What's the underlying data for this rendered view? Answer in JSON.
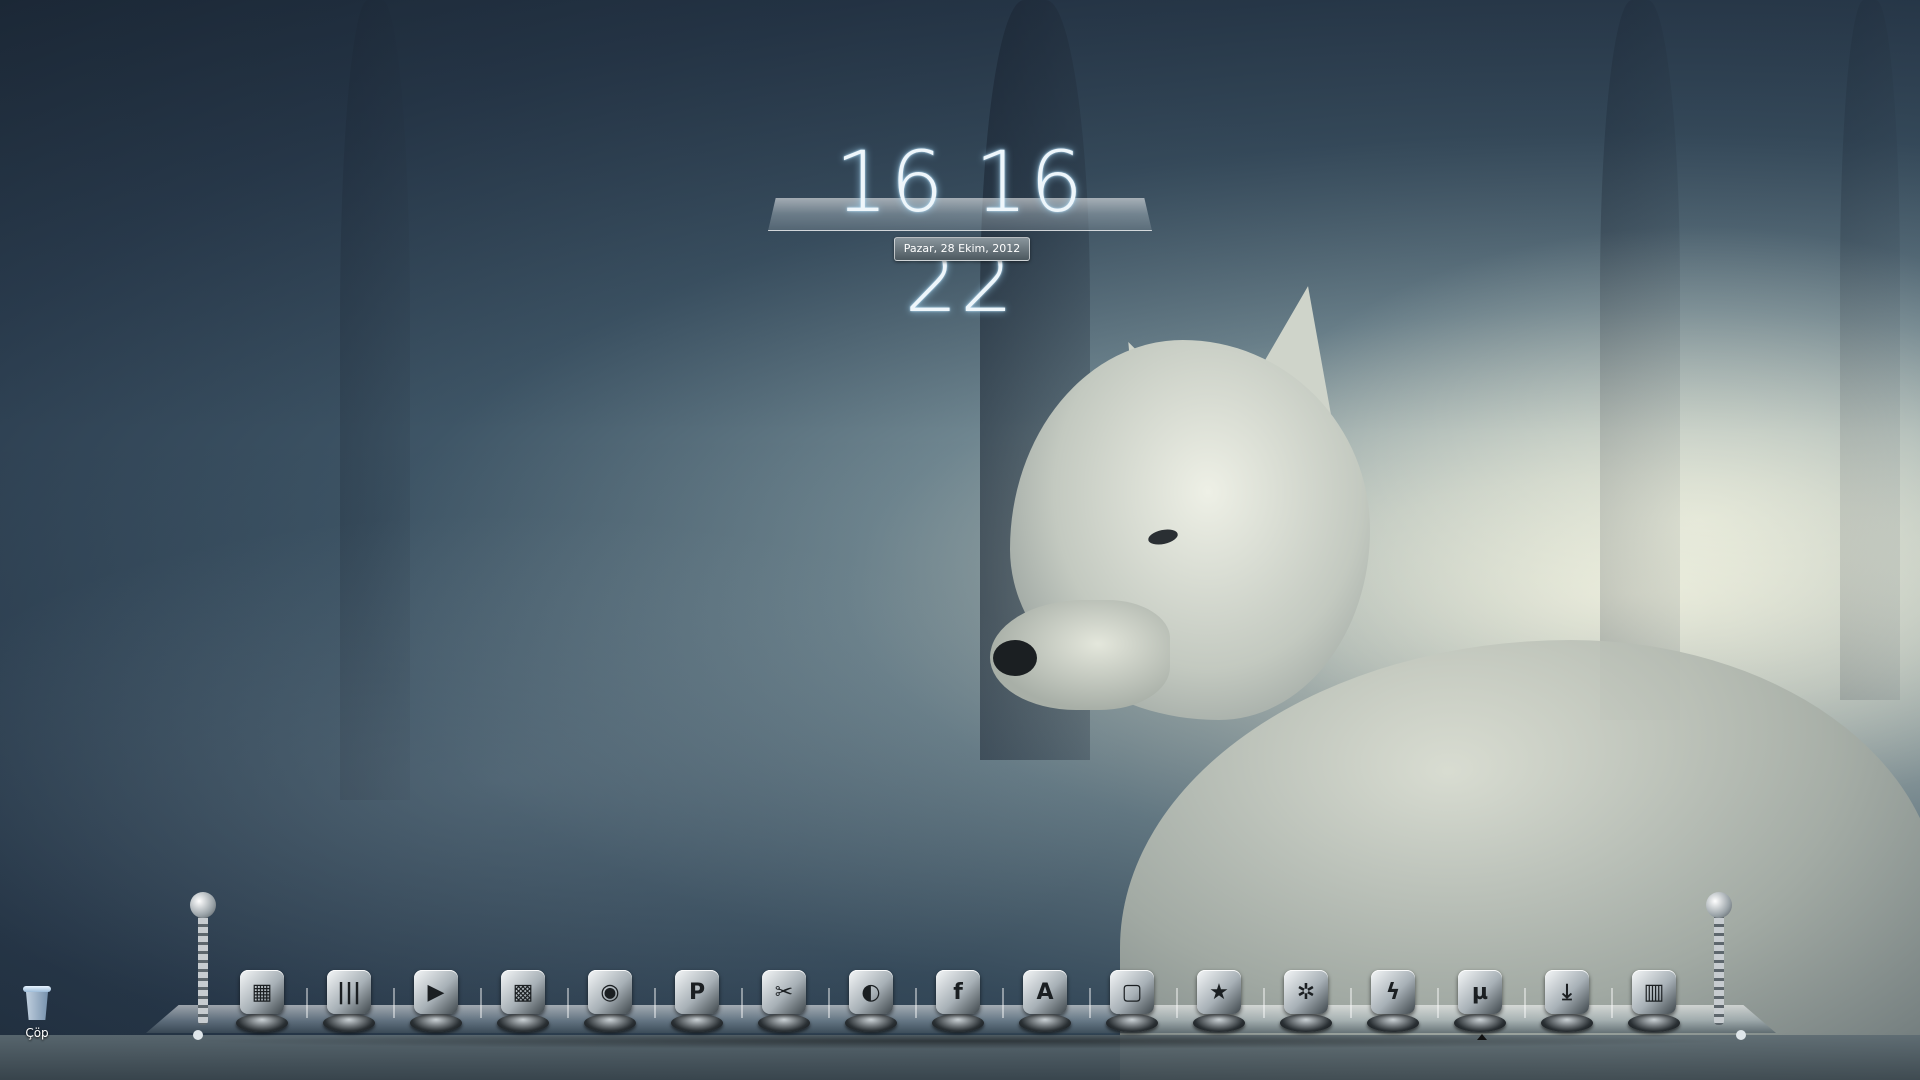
{
  "clock": {
    "time": "16 16 22",
    "date": "Pazar, 28 Ekim, 2012"
  },
  "desktop": {
    "recycle_bin_label": "Çöp"
  },
  "dock": {
    "items": [
      {
        "icon": "photo-viewer-icon",
        "glyph": "▦"
      },
      {
        "icon": "library-books-icon",
        "glyph": "|||"
      },
      {
        "icon": "media-player-icon",
        "glyph": "▶"
      },
      {
        "icon": "photo-editor-icon",
        "glyph": "▩"
      },
      {
        "icon": "speakers-icon",
        "glyph": "◉"
      },
      {
        "icon": "powerpoint-icon",
        "glyph": "P"
      },
      {
        "icon": "tools-wrench-icon",
        "glyph": "✂"
      },
      {
        "icon": "browser-globe-icon",
        "glyph": "◐"
      },
      {
        "icon": "facebook-icon",
        "glyph": "f"
      },
      {
        "icon": "adobe-reader-icon",
        "glyph": "A"
      },
      {
        "icon": "shopping-bag-icon",
        "glyph": "▢"
      },
      {
        "icon": "favorites-star-icon",
        "glyph": "★"
      },
      {
        "icon": "settings-gears-icon",
        "glyph": "✲"
      },
      {
        "icon": "winamp-bolt-icon",
        "glyph": "ϟ"
      },
      {
        "icon": "utorrent-icon",
        "glyph": "µ"
      },
      {
        "icon": "download-manager-icon",
        "glyph": "⤓"
      },
      {
        "icon": "trash-can-icon",
        "glyph": "▥"
      }
    ]
  }
}
